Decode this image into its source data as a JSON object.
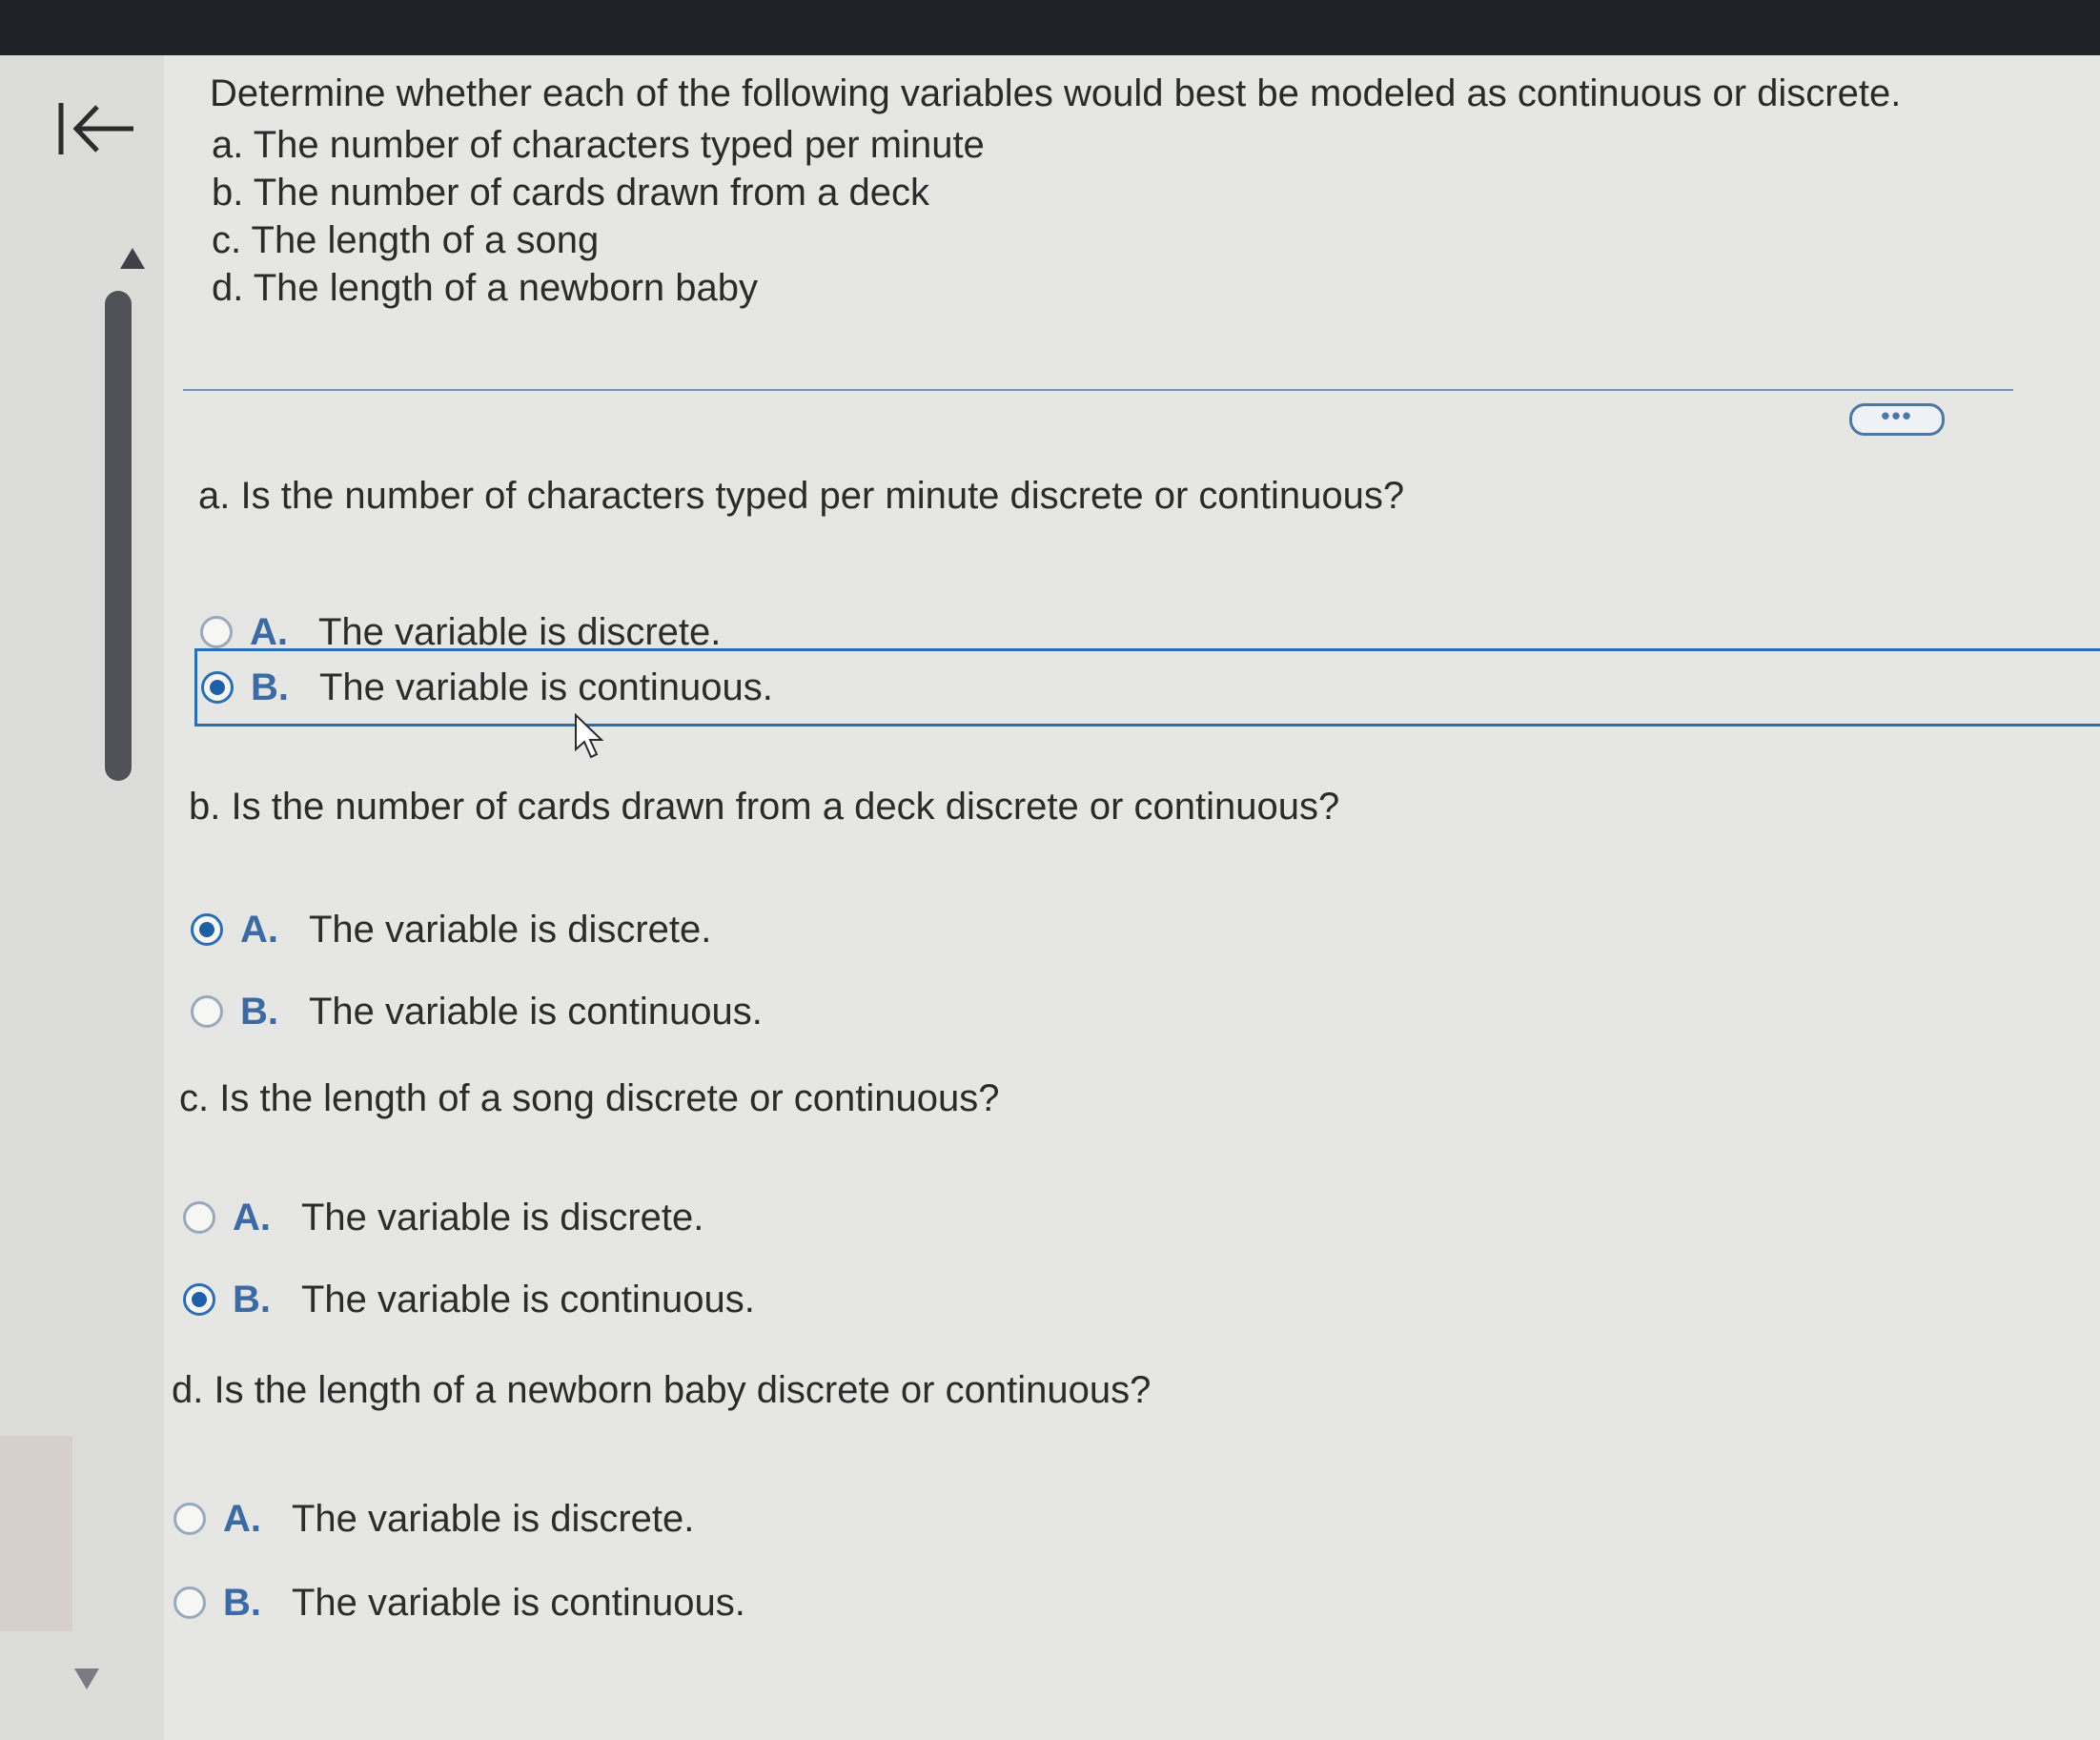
{
  "header": {
    "intro_title": "Determine whether each of the following variables would best be modeled as continuous or discrete.",
    "items": [
      "a. The number of characters typed per minute",
      "b. The number of cards drawn from a deck",
      "c. The length of a song",
      "d. The length of a newborn baby"
    ]
  },
  "toolbar": {
    "more_label": "•••"
  },
  "icons": {
    "back": "back-to-start-icon",
    "scroll_up": "scroll-up-icon",
    "scroll_down": "scroll-down-icon",
    "cursor": "mouse-cursor-icon"
  },
  "colors": {
    "accent": "#2f6db1",
    "letter": "#3c6aa3",
    "top_bar": "#1f2228",
    "scroll_thumb": "#505257"
  },
  "questions": [
    {
      "text": "a. Is the number of characters typed per minute discrete or continuous?",
      "options": [
        {
          "letter": "A.",
          "text": "The variable is discrete.",
          "selected": false
        },
        {
          "letter": "B.",
          "text": "The variable is continuous.",
          "selected": true
        }
      ]
    },
    {
      "text": "b. Is the number of cards drawn from a deck discrete or continuous?",
      "options": [
        {
          "letter": "A.",
          "text": "The variable is discrete.",
          "selected": true
        },
        {
          "letter": "B.",
          "text": "The variable is continuous.",
          "selected": false
        }
      ]
    },
    {
      "text": "c. Is the length of a song discrete or continuous?",
      "options": [
        {
          "letter": "A.",
          "text": "The variable is discrete.",
          "selected": false
        },
        {
          "letter": "B.",
          "text": "The variable is continuous.",
          "selected": true
        }
      ]
    },
    {
      "text": "d. Is the length of a newborn baby discrete or continuous?",
      "options": [
        {
          "letter": "A.",
          "text": "The variable is discrete.",
          "selected": false
        },
        {
          "letter": "B.",
          "text": "The variable is continuous.",
          "selected": false
        }
      ]
    }
  ]
}
